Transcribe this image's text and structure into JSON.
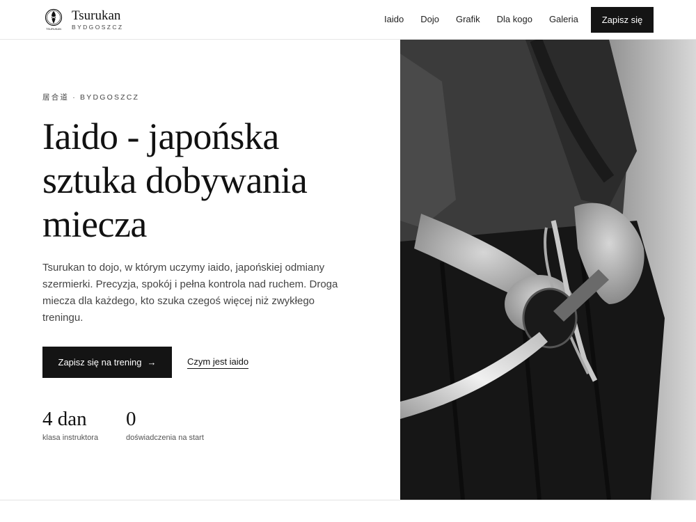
{
  "header": {
    "brand_name": "Tsurukan",
    "brand_city": "BYDGOSZCZ",
    "logo_caption": "TSURUKAN",
    "nav": [
      {
        "label": "Iaido"
      },
      {
        "label": "Dojo"
      },
      {
        "label": "Grafik"
      },
      {
        "label": "Dla kogo"
      },
      {
        "label": "Galeria"
      }
    ],
    "cta_label": "Zapisz się"
  },
  "hero": {
    "eyebrow": "居合道 · BYDGOSZCZ",
    "headline_lines": [
      "Iaido - japońska",
      "sztuka dobywania",
      "miecza"
    ],
    "lead": "Tsurukan to dojo, w którym uczymy iaido, japońskiej odmiany szermierki. Precyzja, spokój i pełna kontrola nad ruchem. Droga miecza dla każdego, kto szuka czegoś więcej niż zwykłego treningu.",
    "primary_button": "Zapisz się na trening",
    "primary_button_icon": "arrow-right-icon",
    "secondary_link": "Czym jest iaido",
    "stats": [
      {
        "value": "4 dan",
        "label": "klasa instruktora"
      },
      {
        "value": "0",
        "label": "doświadczenia na start"
      }
    ],
    "image_description_icon": "iaido-practitioner-photo"
  },
  "colors": {
    "background": "#ffffff",
    "text": "#111111",
    "muted": "#444444",
    "button": "#141414"
  }
}
